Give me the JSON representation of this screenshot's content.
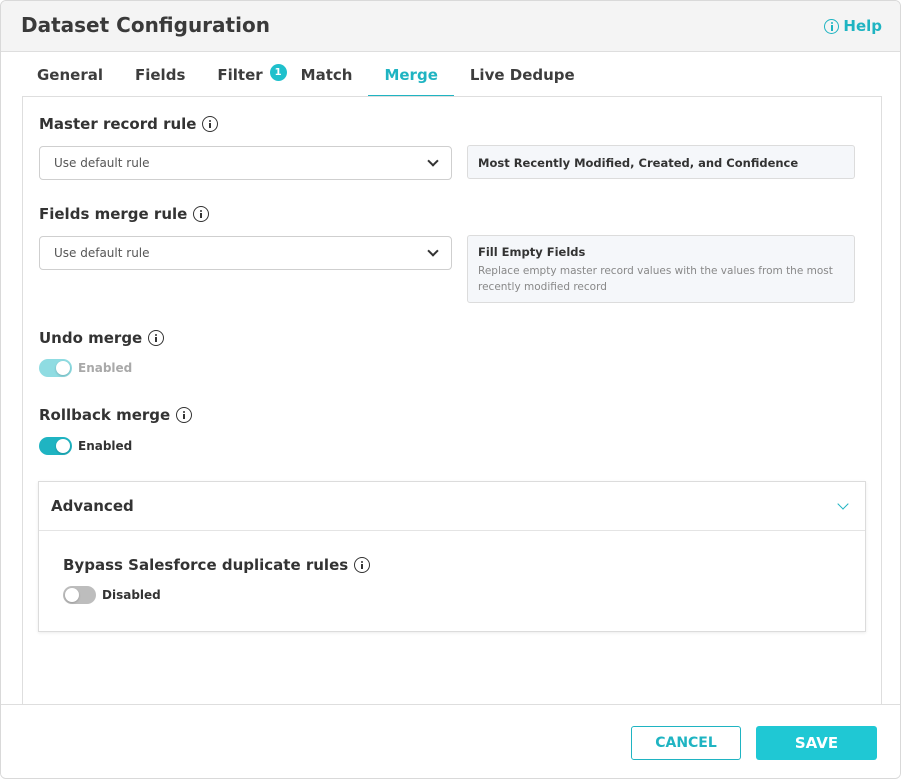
{
  "dialog": {
    "title": "Dataset Configuration",
    "help_label": "Help"
  },
  "tabs": [
    {
      "label": "General",
      "active": false
    },
    {
      "label": "Fields",
      "active": false
    },
    {
      "label": "Filter",
      "active": false,
      "badge": "1"
    },
    {
      "label": "Match",
      "active": false
    },
    {
      "label": "Merge",
      "active": true
    },
    {
      "label": "Live Dedupe",
      "active": false
    }
  ],
  "master_record": {
    "label": "Master record rule",
    "select_value": "Use default rule",
    "info_title": "Most Recently Modified, Created, and Confidence"
  },
  "fields_merge": {
    "label": "Fields merge rule",
    "select_value": "Use default rule",
    "info_title": "Fill Empty Fields",
    "info_desc": "Replace empty master record values with the values from the most recently modified record"
  },
  "undo_merge": {
    "label": "Undo merge",
    "toggle_text": "Enabled",
    "state": "on-disabled"
  },
  "rollback_merge": {
    "label": "Rollback merge",
    "toggle_text": "Enabled",
    "state": "on"
  },
  "advanced": {
    "title": "Advanced",
    "bypass": {
      "label": "Bypass Salesforce duplicate rules",
      "toggle_text": "Disabled",
      "state": "off"
    }
  },
  "footer": {
    "cancel_label": "CANCEL",
    "save_label": "SAVE"
  },
  "colors": {
    "accent": "#1fb4c2",
    "save_bg": "#1fc8d4"
  }
}
